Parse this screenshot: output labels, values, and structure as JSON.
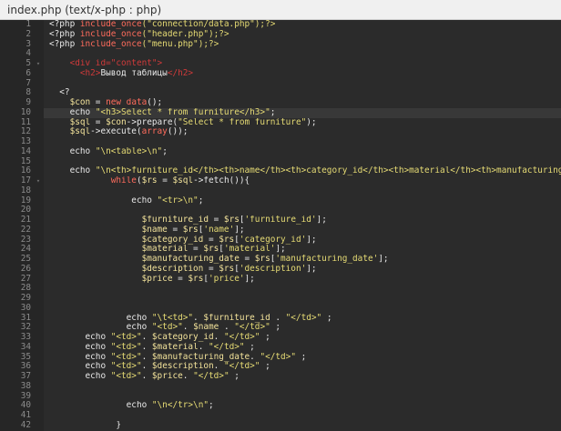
{
  "window": {
    "title": "index.php (text/x-php : php)"
  },
  "lines": [
    {
      "n": "1",
      "fold": "",
      "tokens": [
        {
          "t": "<?php ",
          "c": "php"
        },
        {
          "t": "include_once",
          "c": "keyword"
        },
        {
          "t": "(\"connection/data.php\");?>",
          "c": "string"
        }
      ]
    },
    {
      "n": "2",
      "fold": "",
      "tokens": [
        {
          "t": "<?php ",
          "c": "php"
        },
        {
          "t": "include_once",
          "c": "keyword"
        },
        {
          "t": "(\"header.php\");?>",
          "c": "string"
        }
      ]
    },
    {
      "n": "3",
      "fold": "",
      "tokens": [
        {
          "t": "<?php ",
          "c": "php"
        },
        {
          "t": "include_once",
          "c": "keyword"
        },
        {
          "t": "(\"menu.php\");?>",
          "c": "string"
        }
      ]
    },
    {
      "n": "4",
      "fold": "",
      "tokens": []
    },
    {
      "n": "5",
      "fold": "▾",
      "tokens": [
        {
          "t": "    ",
          "c": "plain"
        },
        {
          "t": "<div id=\"content\">",
          "c": "tag"
        }
      ]
    },
    {
      "n": "6",
      "fold": "",
      "tokens": [
        {
          "t": "      ",
          "c": "plain"
        },
        {
          "t": "<h2>",
          "c": "tag"
        },
        {
          "t": "Вывод таблицы",
          "c": "plain"
        },
        {
          "t": "</h2>",
          "c": "tag"
        }
      ]
    },
    {
      "n": "7",
      "fold": "",
      "tokens": []
    },
    {
      "n": "8",
      "fold": "",
      "tokens": [
        {
          "t": "  <?",
          "c": "php"
        }
      ]
    },
    {
      "n": "9",
      "fold": "",
      "tokens": [
        {
          "t": "    $con",
          "c": "variable"
        },
        {
          "t": " = ",
          "c": "plain"
        },
        {
          "t": "new",
          "c": "keyword"
        },
        {
          "t": " data",
          "c": "keyword"
        },
        {
          "t": "();",
          "c": "plain"
        }
      ]
    },
    {
      "n": "10",
      "fold": "",
      "current": true,
      "tokens": [
        {
          "t": "    echo ",
          "c": "plain"
        },
        {
          "t": "\"<h3>Select * from furniture</h3>\"",
          "c": "string"
        },
        {
          "t": ";",
          "c": "plain"
        }
      ]
    },
    {
      "n": "11",
      "fold": "",
      "tokens": [
        {
          "t": "    $sql",
          "c": "variable"
        },
        {
          "t": " = ",
          "c": "plain"
        },
        {
          "t": "$con",
          "c": "variable"
        },
        {
          "t": "->prepare(",
          "c": "plain"
        },
        {
          "t": "\"Select * from furniture\"",
          "c": "string"
        },
        {
          "t": ");",
          "c": "plain"
        }
      ]
    },
    {
      "n": "12",
      "fold": "",
      "tokens": [
        {
          "t": "    $sql",
          "c": "variable"
        },
        {
          "t": "->execute(",
          "c": "plain"
        },
        {
          "t": "array",
          "c": "keyword"
        },
        {
          "t": "());",
          "c": "plain"
        }
      ]
    },
    {
      "n": "13",
      "fold": "",
      "tokens": []
    },
    {
      "n": "14",
      "fold": "",
      "tokens": [
        {
          "t": "    echo ",
          "c": "plain"
        },
        {
          "t": "\"\\n<table>\\n\"",
          "c": "string"
        },
        {
          "t": ";",
          "c": "plain"
        }
      ]
    },
    {
      "n": "15",
      "fold": "",
      "tokens": []
    },
    {
      "n": "16",
      "fold": "",
      "tokens": [
        {
          "t": "    echo ",
          "c": "plain"
        },
        {
          "t": "\"\\n<th>furniture_id</th><th>name</th><th>category_id</th><th>material</th><th>manufacturing_date</th>",
          "c": "string"
        }
      ]
    },
    {
      "n": "17",
      "fold": "▾",
      "tokens": [
        {
          "t": "            ",
          "c": "plain"
        },
        {
          "t": "while",
          "c": "keyword"
        },
        {
          "t": "(",
          "c": "plain"
        },
        {
          "t": "$rs",
          "c": "variable"
        },
        {
          "t": " = ",
          "c": "plain"
        },
        {
          "t": "$sql",
          "c": "variable"
        },
        {
          "t": "->fetch()){",
          "c": "plain"
        }
      ]
    },
    {
      "n": "18",
      "fold": "",
      "tokens": []
    },
    {
      "n": "19",
      "fold": "",
      "tokens": [
        {
          "t": "                echo ",
          "c": "plain"
        },
        {
          "t": "\"<tr>\\n\"",
          "c": "string"
        },
        {
          "t": ";",
          "c": "plain"
        }
      ]
    },
    {
      "n": "20",
      "fold": "",
      "tokens": []
    },
    {
      "n": "21",
      "fold": "",
      "tokens": [
        {
          "t": "                  $furniture_id",
          "c": "variable"
        },
        {
          "t": " = ",
          "c": "plain"
        },
        {
          "t": "$rs",
          "c": "variable"
        },
        {
          "t": "[",
          "c": "plain"
        },
        {
          "t": "'furniture_id'",
          "c": "string"
        },
        {
          "t": "];",
          "c": "plain"
        }
      ]
    },
    {
      "n": "22",
      "fold": "",
      "tokens": [
        {
          "t": "                  $name",
          "c": "variable"
        },
        {
          "t": " = ",
          "c": "plain"
        },
        {
          "t": "$rs",
          "c": "variable"
        },
        {
          "t": "[",
          "c": "plain"
        },
        {
          "t": "'name'",
          "c": "string"
        },
        {
          "t": "];",
          "c": "plain"
        }
      ]
    },
    {
      "n": "23",
      "fold": "",
      "tokens": [
        {
          "t": "                  $category_id",
          "c": "variable"
        },
        {
          "t": " = ",
          "c": "plain"
        },
        {
          "t": "$rs",
          "c": "variable"
        },
        {
          "t": "[",
          "c": "plain"
        },
        {
          "t": "'category_id'",
          "c": "string"
        },
        {
          "t": "];",
          "c": "plain"
        }
      ]
    },
    {
      "n": "24",
      "fold": "",
      "tokens": [
        {
          "t": "                  $material",
          "c": "variable"
        },
        {
          "t": " = ",
          "c": "plain"
        },
        {
          "t": "$rs",
          "c": "variable"
        },
        {
          "t": "[",
          "c": "plain"
        },
        {
          "t": "'material'",
          "c": "string"
        },
        {
          "t": "];",
          "c": "plain"
        }
      ]
    },
    {
      "n": "25",
      "fold": "",
      "tokens": [
        {
          "t": "                  $manufacturing_date",
          "c": "variable"
        },
        {
          "t": " = ",
          "c": "plain"
        },
        {
          "t": "$rs",
          "c": "variable"
        },
        {
          "t": "[",
          "c": "plain"
        },
        {
          "t": "'manufacturing_date'",
          "c": "string"
        },
        {
          "t": "];",
          "c": "plain"
        }
      ]
    },
    {
      "n": "26",
      "fold": "",
      "tokens": [
        {
          "t": "                  $description",
          "c": "variable"
        },
        {
          "t": " = ",
          "c": "plain"
        },
        {
          "t": "$rs",
          "c": "variable"
        },
        {
          "t": "[",
          "c": "plain"
        },
        {
          "t": "'description'",
          "c": "string"
        },
        {
          "t": "];",
          "c": "plain"
        }
      ]
    },
    {
      "n": "27",
      "fold": "",
      "tokens": [
        {
          "t": "                  $price",
          "c": "variable"
        },
        {
          "t": " = ",
          "c": "plain"
        },
        {
          "t": "$rs",
          "c": "variable"
        },
        {
          "t": "[",
          "c": "plain"
        },
        {
          "t": "'price'",
          "c": "string"
        },
        {
          "t": "];",
          "c": "plain"
        }
      ]
    },
    {
      "n": "28",
      "fold": "",
      "tokens": []
    },
    {
      "n": "29",
      "fold": "",
      "tokens": []
    },
    {
      "n": "30",
      "fold": "",
      "tokens": []
    },
    {
      "n": "31",
      "fold": "",
      "tokens": [
        {
          "t": "               echo ",
          "c": "plain"
        },
        {
          "t": "\"\\t<td>\"",
          "c": "string"
        },
        {
          "t": ". ",
          "c": "plain"
        },
        {
          "t": "$furniture_id",
          "c": "variable"
        },
        {
          "t": " . ",
          "c": "plain"
        },
        {
          "t": "\"</td>\"",
          "c": "string"
        },
        {
          "t": " ;",
          "c": "plain"
        }
      ]
    },
    {
      "n": "32",
      "fold": "",
      "tokens": [
        {
          "t": "               echo ",
          "c": "plain"
        },
        {
          "t": "\"<td>\"",
          "c": "string"
        },
        {
          "t": ". ",
          "c": "plain"
        },
        {
          "t": "$name",
          "c": "variable"
        },
        {
          "t": " . ",
          "c": "plain"
        },
        {
          "t": "\"</td>\"",
          "c": "string"
        },
        {
          "t": " ;",
          "c": "plain"
        }
      ]
    },
    {
      "n": "33",
      "fold": "",
      "tokens": [
        {
          "t": "       echo ",
          "c": "plain"
        },
        {
          "t": "\"<td>\"",
          "c": "string"
        },
        {
          "t": ". ",
          "c": "plain"
        },
        {
          "t": "$category_id",
          "c": "variable"
        },
        {
          "t": ". ",
          "c": "plain"
        },
        {
          "t": "\"</td>\"",
          "c": "string"
        },
        {
          "t": " ;",
          "c": "plain"
        }
      ]
    },
    {
      "n": "34",
      "fold": "",
      "tokens": [
        {
          "t": "       echo ",
          "c": "plain"
        },
        {
          "t": "\"<td>\"",
          "c": "string"
        },
        {
          "t": ". ",
          "c": "plain"
        },
        {
          "t": "$material",
          "c": "variable"
        },
        {
          "t": ". ",
          "c": "plain"
        },
        {
          "t": "\"</td>\"",
          "c": "string"
        },
        {
          "t": " ;",
          "c": "plain"
        }
      ]
    },
    {
      "n": "35",
      "fold": "",
      "tokens": [
        {
          "t": "       echo ",
          "c": "plain"
        },
        {
          "t": "\"<td>\"",
          "c": "string"
        },
        {
          "t": ". ",
          "c": "plain"
        },
        {
          "t": "$manufacturing_date",
          "c": "variable"
        },
        {
          "t": ". ",
          "c": "plain"
        },
        {
          "t": "\"</td>\"",
          "c": "string"
        },
        {
          "t": " ;",
          "c": "plain"
        }
      ]
    },
    {
      "n": "36",
      "fold": "",
      "tokens": [
        {
          "t": "       echo ",
          "c": "plain"
        },
        {
          "t": "\"<td>\"",
          "c": "string"
        },
        {
          "t": ". ",
          "c": "plain"
        },
        {
          "t": "$description",
          "c": "variable"
        },
        {
          "t": ". ",
          "c": "plain"
        },
        {
          "t": "\"</td>\"",
          "c": "string"
        },
        {
          "t": " ;",
          "c": "plain"
        }
      ]
    },
    {
      "n": "37",
      "fold": "",
      "tokens": [
        {
          "t": "       echo ",
          "c": "plain"
        },
        {
          "t": "\"<td>\"",
          "c": "string"
        },
        {
          "t": ". ",
          "c": "plain"
        },
        {
          "t": "$price",
          "c": "variable"
        },
        {
          "t": ". ",
          "c": "plain"
        },
        {
          "t": "\"</td>\"",
          "c": "string"
        },
        {
          "t": " ;",
          "c": "plain"
        }
      ]
    },
    {
      "n": "38",
      "fold": "",
      "tokens": []
    },
    {
      "n": "39",
      "fold": "",
      "tokens": []
    },
    {
      "n": "40",
      "fold": "",
      "tokens": [
        {
          "t": "               echo ",
          "c": "plain"
        },
        {
          "t": "\"\\n</tr>\\n\"",
          "c": "string"
        },
        {
          "t": ";",
          "c": "plain"
        }
      ]
    },
    {
      "n": "41",
      "fold": "",
      "tokens": []
    },
    {
      "n": "42",
      "fold": "",
      "tokens": [
        {
          "t": "             }",
          "c": "plain"
        }
      ]
    }
  ]
}
